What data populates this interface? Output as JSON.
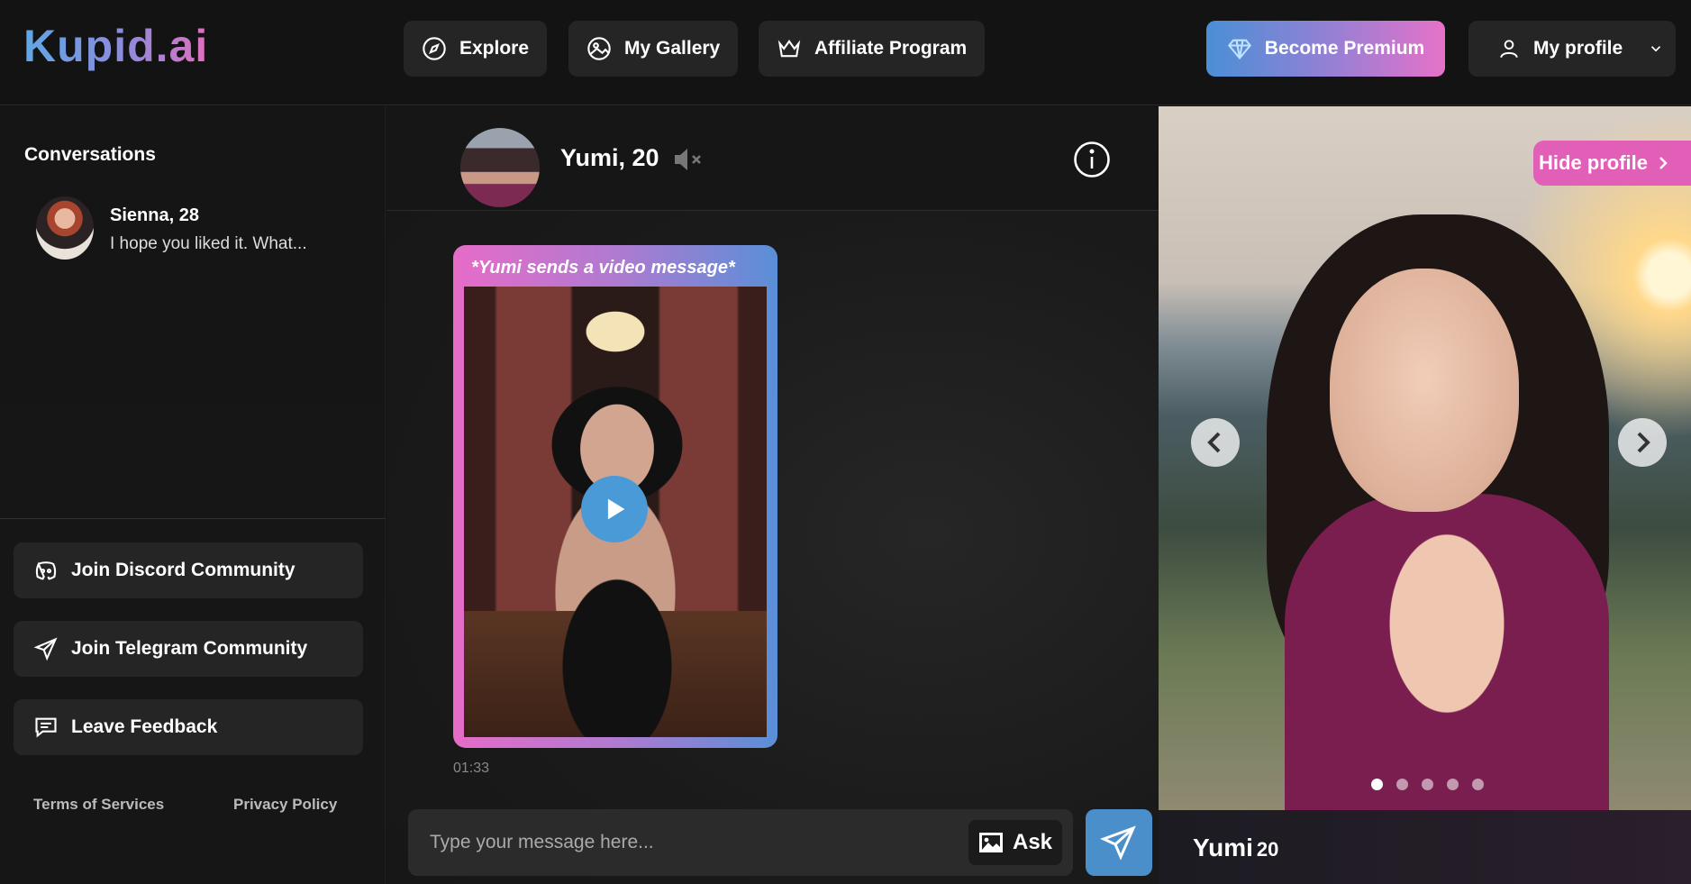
{
  "brand": {
    "logo": "Kupid.ai"
  },
  "nav": {
    "explore": "Explore",
    "gallery": "My Gallery",
    "affiliate": "Affiliate Program",
    "premium": "Become Premium",
    "profile": "My profile"
  },
  "sidebar": {
    "title": "Conversations",
    "conversations": [
      {
        "name": "Sienna, 28",
        "preview": "I hope you liked it. What..."
      }
    ],
    "buttons": {
      "discord": "Join Discord Community",
      "telegram": "Join Telegram Community",
      "feedback": "Leave Feedback"
    },
    "footer": {
      "terms": "Terms of Services",
      "privacy": "Privacy Policy"
    }
  },
  "chat": {
    "name": "Yumi, 20",
    "message": {
      "caption": "*Yumi sends a video message*",
      "time": "01:33"
    },
    "input_placeholder": "Type your message here...",
    "ask_label": "Ask"
  },
  "profile": {
    "hide_label": "Hide profile",
    "name": "Yumi",
    "age": "20",
    "carousel": {
      "count": 5,
      "active": 0
    }
  },
  "colors": {
    "accent_pink": "#e25fb8",
    "accent_blue": "#4a8fca",
    "panel": "#252525",
    "background": "#131313"
  }
}
